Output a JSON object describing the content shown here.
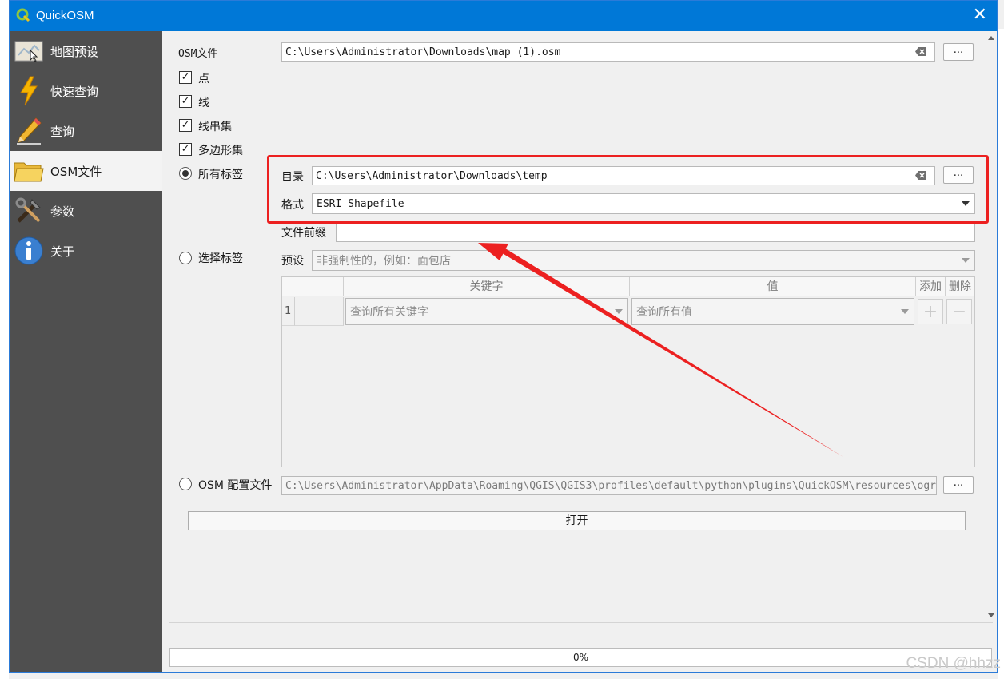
{
  "window": {
    "title": "QuickOSM",
    "close_glyph": "✕"
  },
  "sidebar": {
    "items": [
      {
        "label": "地图预设",
        "icon": "map-preset-icon",
        "active": false
      },
      {
        "label": "快速查询",
        "icon": "lightning-icon",
        "active": false
      },
      {
        "label": "查询",
        "icon": "pencil-icon",
        "active": false
      },
      {
        "label": "OSM文件",
        "icon": "folder-icon",
        "active": true
      },
      {
        "label": "参数",
        "icon": "tools-icon",
        "active": false
      },
      {
        "label": "关于",
        "icon": "info-icon",
        "active": false
      }
    ]
  },
  "osm_file": {
    "label": "OSM文件",
    "path": "C:\\Users\\Administrator\\Downloads\\map (1).osm",
    "browse_label": "..."
  },
  "layers": {
    "points": {
      "label": "点",
      "checked": true
    },
    "lines": {
      "label": "线",
      "checked": true
    },
    "multilinestrings": {
      "label": "线串集",
      "checked": true
    },
    "multipolygons": {
      "label": "多边形集",
      "checked": true
    }
  },
  "tag_mode": {
    "all_tags": {
      "label": "所有标签",
      "selected": true
    },
    "select_tags": {
      "label": "选择标签",
      "selected": false
    },
    "osm_config": {
      "label": "OSM 配置文件",
      "selected": false
    }
  },
  "output": {
    "directory_label": "目录",
    "directory_value": "C:\\Users\\Administrator\\Downloads\\temp",
    "directory_browse": "...",
    "format_label": "格式",
    "format_value": "ESRI Shapefile",
    "prefix_label": "文件前缀",
    "prefix_value": ""
  },
  "preset": {
    "label": "预设",
    "placeholder": "非强制性的，例如：面包店"
  },
  "tags_table": {
    "headers": {
      "key": "关键字",
      "value": "值",
      "add": "添加",
      "delete": "删除"
    },
    "rows": [
      {
        "index": "1",
        "key_placeholder": "查询所有关键字",
        "value_placeholder": "查询所有值"
      }
    ]
  },
  "config_file": {
    "path": "C:\\Users\\Administrator\\AppData\\Roaming\\QGIS\\QGIS3\\profiles\\default\\python\\plugins\\QuickOSM\\resources\\ogr\\t",
    "browse_label": "..."
  },
  "open_button": "打开",
  "progress": {
    "value": 0,
    "label": "0%"
  },
  "watermark": "CSDN @hhzz",
  "annotation_color": "#ec2020"
}
